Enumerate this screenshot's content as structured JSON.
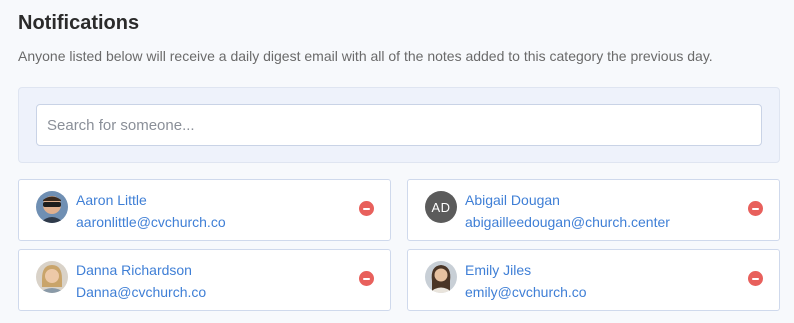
{
  "header": {
    "title": "Notifications",
    "description": "Anyone listed below will receive a daily digest email with all of the notes added to this category the previous day."
  },
  "search": {
    "placeholder": "Search for someone...",
    "value": ""
  },
  "recipients": [
    {
      "name": "Aaron Little",
      "email": "aaronlittle@cvchurch.co",
      "avatar": "photo"
    },
    {
      "name": "Abigail Dougan",
      "email": "abigailleedougan@church.center",
      "avatar": "initials",
      "initials": "AD"
    },
    {
      "name": "Danna Richardson",
      "email": "Danna@cvchurch.co",
      "avatar": "photo"
    },
    {
      "name": "Emily Jiles",
      "email": "emily@cvchurch.co",
      "avatar": "photo"
    }
  ],
  "colors": {
    "link": "#3f7fd6",
    "remove": "#e8605c",
    "panel": "#eef2fb"
  },
  "icons": {
    "remove": "minus-circle-icon"
  }
}
